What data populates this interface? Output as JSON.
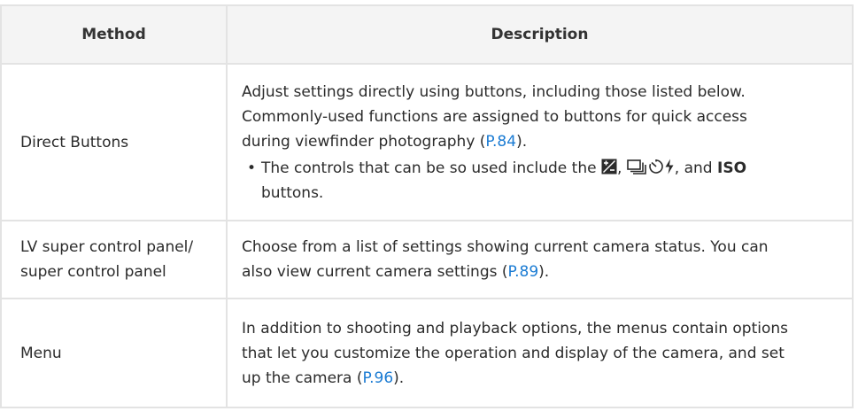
{
  "table": {
    "header": {
      "method": "Method",
      "description": "Description"
    },
    "rows": [
      {
        "method": "Direct Buttons",
        "desc_lines": [
          "Adjust settings directly using buttons, including those listed below.",
          "Commonly-used functions are assigned to buttons for quick access"
        ],
        "desc_line3_before": "during viewfinder photography (",
        "desc_line3_link": "P.84",
        "desc_line3_after": ").",
        "bullet": {
          "marker": "•",
          "before": "The controls that can be so used include the",
          "comma_1": ",",
          "comma_2": ", and",
          "iso": "ISO",
          "after": "buttons."
        }
      },
      {
        "method_line1": "LV super control panel/",
        "method_line2": "super control panel",
        "desc_line1": "Choose from a list of settings showing current camera status. You can",
        "desc_line2_before": "also view current camera settings (",
        "desc_line2_link": "P.89",
        "desc_line2_after": ")."
      },
      {
        "method": "Menu",
        "desc_lines": [
          "In addition to shooting and playback options, the menus contain options",
          "that let you customize the operation and display of the camera, and set"
        ],
        "desc_line3_before": "up the camera (",
        "desc_line3_link": "P.96",
        "desc_line3_after": ")."
      }
    ]
  },
  "colors": {
    "link": "#1a7bd3",
    "header_bg": "#f4f4f4",
    "border": "#e3e3e3"
  },
  "icons": [
    "exposure-compensation-icon",
    "drive-mode-icon",
    "self-timer-icon",
    "flash-icon"
  ]
}
